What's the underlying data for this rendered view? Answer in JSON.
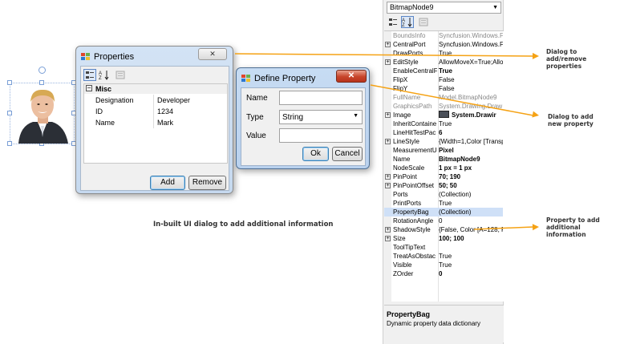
{
  "properties_dialog": {
    "title": "Properties",
    "category": "Misc",
    "rows": [
      {
        "name": "Designation",
        "value": "Developer"
      },
      {
        "name": "ID",
        "value": "1234"
      },
      {
        "name": "Name",
        "value": "Mark"
      }
    ],
    "add_label": "Add",
    "remove_label": "Remove"
  },
  "define_dialog": {
    "title": "Define Property",
    "name_label": "Name",
    "name_value": "",
    "type_label": "Type",
    "type_value": "String",
    "value_label": "Value",
    "value_value": "",
    "ok_label": "Ok",
    "cancel_label": "Cancel"
  },
  "captions": {
    "main": "In-built UI dialog to add additional information",
    "dialog_add_remove": [
      "Dialog to",
      "add/remove",
      "properties"
    ],
    "dialog_add_new": [
      "Dialog to add",
      "new property"
    ],
    "property_info": [
      "Property to add",
      "additional",
      "information"
    ]
  },
  "grid": {
    "selector": "BitmapNode9",
    "rows": [
      {
        "n": "BoundsInfo",
        "v": "Syncfusion.Windows.F",
        "ro": true
      },
      {
        "n": "CentralPort",
        "v": "Syncfusion.Windows.F",
        "exp": true
      },
      {
        "n": "DrawPorts",
        "v": "True"
      },
      {
        "n": "EditStyle",
        "v": "AllowMoveX=True;Allov",
        "exp": true
      },
      {
        "n": "EnableCentralF",
        "v": "True",
        "b": true
      },
      {
        "n": "FlipX",
        "v": "False"
      },
      {
        "n": "FlipY",
        "v": "False"
      },
      {
        "n": "FullName",
        "v": "Model.BitmapNode9",
        "ro": true
      },
      {
        "n": "GraphicsPath",
        "v": "System.Drawing.Draw",
        "ro": true
      },
      {
        "n": "Image",
        "v": "System.Drawir",
        "exp": true,
        "b": true,
        "img": true
      },
      {
        "n": "InheritContaine",
        "v": "True"
      },
      {
        "n": "LineHitTestPac",
        "v": "6",
        "b": true
      },
      {
        "n": "LineStyle",
        "v": "{Width=1,Color [Transp",
        "exp": true
      },
      {
        "n": "MeasurementU",
        "v": "Pixel",
        "b": true
      },
      {
        "n": "Name",
        "v": "BitmapNode9",
        "b": true
      },
      {
        "n": "NodeScale",
        "v": "1 px = 1 px",
        "b": true
      },
      {
        "n": "PinPoint",
        "v": "70; 190",
        "exp": true,
        "b": true
      },
      {
        "n": "PinPointOffset",
        "v": "50; 50",
        "exp": true,
        "b": true
      },
      {
        "n": "Ports",
        "v": "(Collection)"
      },
      {
        "n": "PrintPorts",
        "v": "True"
      },
      {
        "n": "PropertyBag",
        "v": "(Collection)"
      },
      {
        "n": "RotationAngle",
        "v": "0"
      },
      {
        "n": "ShadowStyle",
        "v": "{False, Color [A=128, F",
        "exp": true
      },
      {
        "n": "Size",
        "v": "100; 100",
        "exp": true,
        "b": true
      },
      {
        "n": "ToolTipText",
        "v": ""
      },
      {
        "n": "TreatAsObstac",
        "v": "True"
      },
      {
        "n": "Visible",
        "v": "True"
      },
      {
        "n": "ZOrder",
        "v": "0",
        "b": true
      }
    ],
    "desc_title": "PropertyBag",
    "desc_text": "Dynamic property data dictionary"
  },
  "colors": {
    "arrow": "#f5a214",
    "selected_row": "#cfe0f7"
  }
}
